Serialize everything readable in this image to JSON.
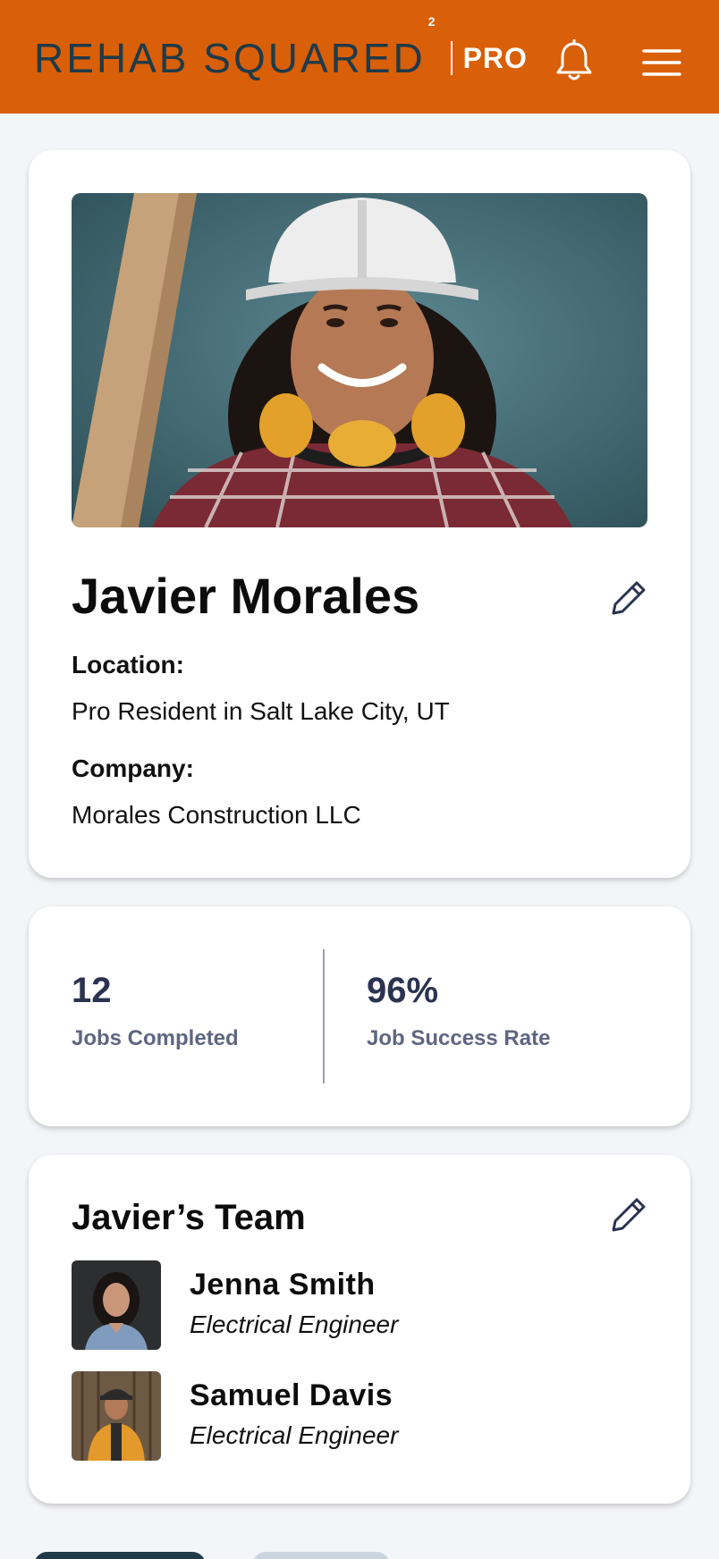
{
  "header": {
    "logo_text_a": "REHAB SQ",
    "logo_text_b": "UARED",
    "logo_superscript": "2",
    "logo_pro": "PRO",
    "bell_icon": "bell-icon",
    "menu_icon": "hamburger-menu-icon"
  },
  "colors": {
    "header_bg": "#d95f08",
    "brand_dark": "#1f3a48",
    "stat_number": "#2b3350",
    "stat_label": "#5f6680"
  },
  "profile": {
    "name": "Javier Morales",
    "location_label": "Location:",
    "location_value": "Pro Resident in Salt Lake City, UT",
    "company_label": "Company:",
    "company_value": "Morales Construction LLC",
    "edit_icon": "pencil-icon"
  },
  "stats": {
    "jobs_completed_value": "12",
    "jobs_completed_label": "Jobs Completed",
    "success_rate_value": "96%",
    "success_rate_label": "Job Success Rate"
  },
  "team": {
    "title": "Javier’s Team",
    "edit_icon": "pencil-icon",
    "members": [
      {
        "name": "Jenna Smith",
        "role": "Electrical Engineer"
      },
      {
        "name": "Samuel Davis",
        "role": "Electrical Engineer"
      }
    ]
  }
}
